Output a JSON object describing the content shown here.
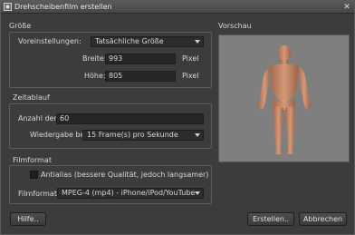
{
  "window": {
    "title": "Drehscheibenfilm erstellen",
    "close_symbol": "✕"
  },
  "size_group": {
    "label": "Größe",
    "preset_label": "Voreinstellungen:",
    "preset_value": "Tatsächliche Größe",
    "width_label": "Breite:",
    "width_value": "993",
    "width_unit": "Pixel",
    "height_label": "Höhe:",
    "height_value": "805",
    "height_unit": "Pixel"
  },
  "time_group": {
    "label": "Zeitablauf",
    "frames_label": "Anzahl der Frames:",
    "frames_value": "60",
    "playback_label": "Wiedergabe bei:",
    "playback_value": "15 Frame(s) pro Sekunde"
  },
  "format_group": {
    "label": "Filmformat",
    "antialias_label": "Antialias (bessere Qualität, jedoch langsamer)",
    "antialias_checked": false,
    "format_label": "Filmformat:",
    "format_value": "MPEG-4 (mp4) - iPhone/iPod/YouTube"
  },
  "preview": {
    "label": "Vorschau"
  },
  "buttons": {
    "help": "Hilfe..",
    "create": "Erstellen..",
    "cancel": "Abbrechen"
  },
  "colors": {
    "preview_bg": "#7f7f7f",
    "figure_skin": "#c98a68"
  }
}
